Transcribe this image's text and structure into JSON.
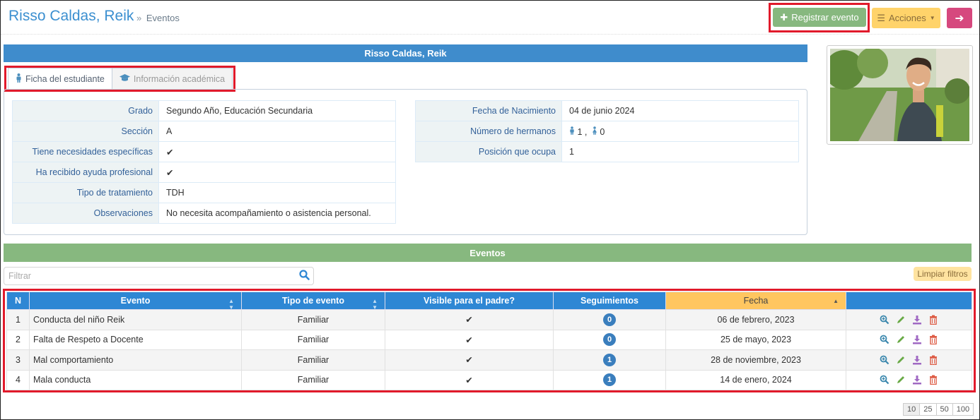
{
  "header": {
    "title": "Risso Caldas, Reik",
    "breadcrumb_sep": "»",
    "breadcrumb": "Eventos",
    "register_label": "Registrar evento",
    "actions_label": "Acciones",
    "back_icon": "arrow-left-icon"
  },
  "student_bar": "Risso Caldas, Reik",
  "tabs": [
    {
      "label": "Ficha del estudiante",
      "icon": "male-icon",
      "active": true
    },
    {
      "label": "Información académica",
      "icon": "graduation-cap-icon",
      "active": false
    }
  ],
  "info_left": [
    {
      "label": "Grado",
      "value": "Segundo Año, Educación Secundaria"
    },
    {
      "label": "Sección",
      "value": "A"
    },
    {
      "label": "Tiene necesidades específicas",
      "value": "✔"
    },
    {
      "label": "Ha recibido ayuda profesional",
      "value": "✔"
    },
    {
      "label": "Tipo de tratamiento",
      "value": "TDH"
    },
    {
      "label": "Observaciones",
      "value": "No necesita acompañamiento o asistencia personal."
    }
  ],
  "info_right": [
    {
      "label": "Fecha de Nacimiento",
      "value": "04 de junio 2024"
    },
    {
      "label": "Número de hermanos",
      "male": "1",
      "sep": ",",
      "female": "0"
    },
    {
      "label": "Posición que ocupa",
      "value": "1"
    }
  ],
  "events_bar": "Eventos",
  "filter": {
    "placeholder": "Filtrar",
    "clear_label": "Limpiar filtros"
  },
  "table": {
    "columns": [
      "N",
      "Evento",
      "Tipo de evento",
      "Visible para el padre?",
      "Seguimientos",
      "Fecha",
      ""
    ],
    "rows": [
      {
        "n": "1",
        "evento": "Conducta del niño Reik",
        "tipo": "Familiar",
        "visible": "✔",
        "seguimientos": "0",
        "fecha": "06 de febrero, 2023"
      },
      {
        "n": "2",
        "evento": "Falta de Respeto a Docente",
        "tipo": "Familiar",
        "visible": "✔",
        "seguimientos": "0",
        "fecha": "25 de mayo, 2023"
      },
      {
        "n": "3",
        "evento": "Mal comportamiento",
        "tipo": "Familiar",
        "visible": "✔",
        "seguimientos": "1",
        "fecha": "28 de noviembre, 2023"
      },
      {
        "n": "4",
        "evento": "Mala conducta",
        "tipo": "Familiar",
        "visible": "✔",
        "seguimientos": "1",
        "fecha": "14 de enero, 2024"
      }
    ]
  },
  "pager": [
    "10",
    "25",
    "50",
    "100"
  ],
  "colors": {
    "blue_bar": "#3f8ccc",
    "green_bar": "#87b87f",
    "highlight": "#e11a2b",
    "header_blue": "#2e87d4",
    "sorted": "#ffc660"
  }
}
